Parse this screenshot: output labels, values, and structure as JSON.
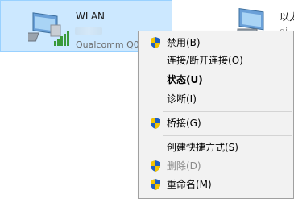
{
  "adapter": {
    "name": "WLAN",
    "vendor": "Qualcomm Q0"
  },
  "second_adapter": {
    "name": "以太",
    "sub": "di"
  },
  "context_menu": {
    "items": [
      {
        "label": "禁用(B)",
        "icon": "uac-shield-icon"
      },
      {
        "label": "连接/断开连接(O)"
      },
      {
        "label": "状态(U)"
      },
      {
        "label": "诊断(I)"
      },
      {
        "label": "桥接(G)",
        "icon": "uac-shield-icon"
      },
      {
        "label": "创建快捷方式(S)"
      },
      {
        "label": "删除(D)",
        "icon": "uac-shield-icon",
        "disabled": true
      },
      {
        "label": "重命名(M)",
        "icon": "uac-shield-icon"
      }
    ]
  },
  "colors": {
    "selection": "#cce8ff",
    "menu_bg": "#f2f2f2",
    "shield_blue": "#1f5fbf",
    "shield_yellow": "#f5c400"
  }
}
